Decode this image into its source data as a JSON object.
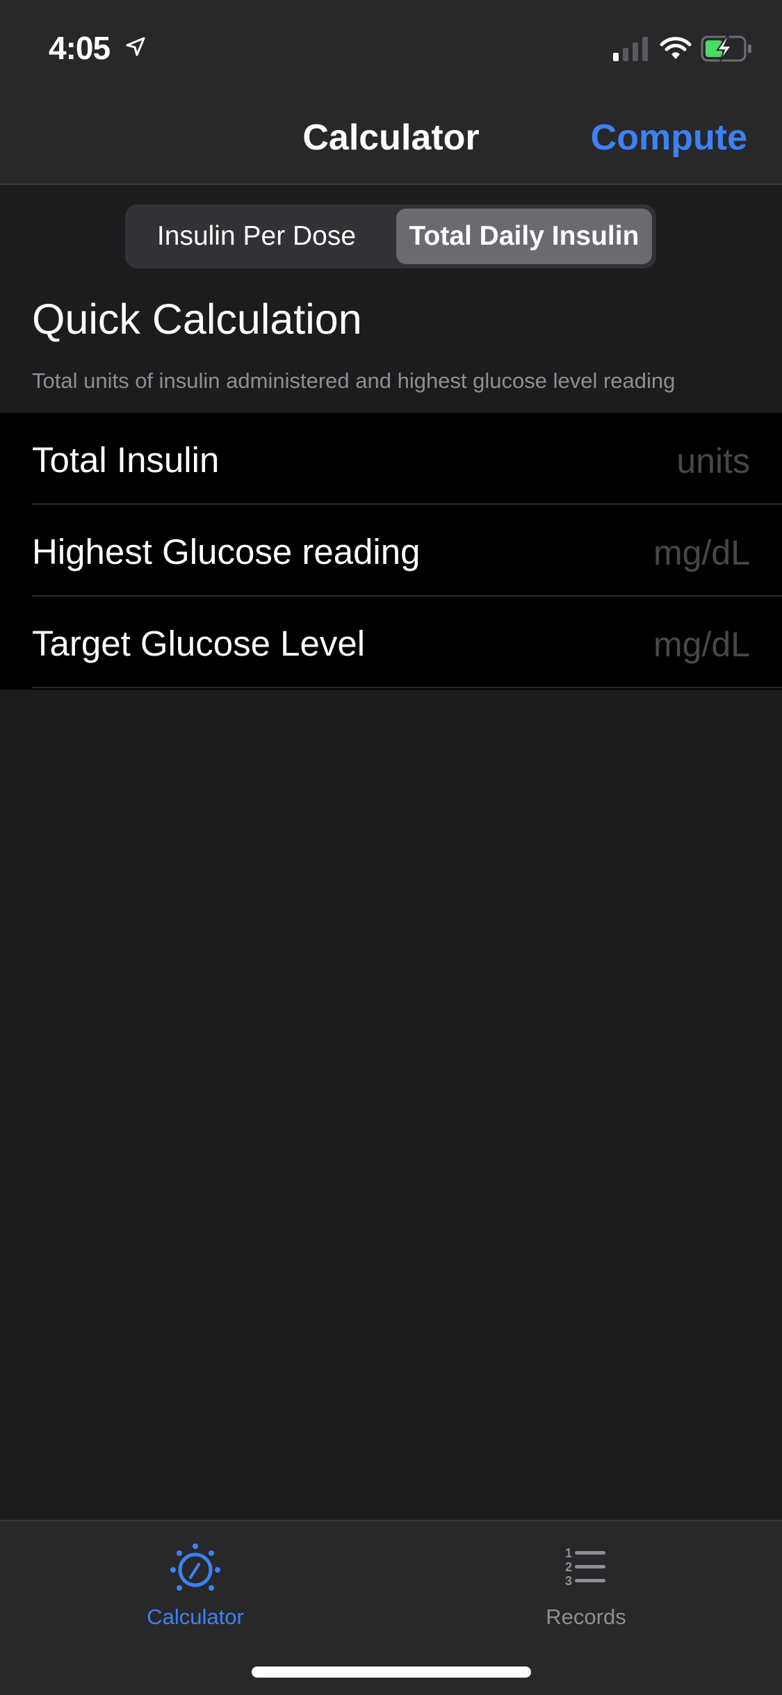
{
  "status_bar": {
    "time": "4:05",
    "icons": [
      "location-arrow-icon",
      "cellular-signal-icon",
      "wifi-icon",
      "battery-charging-icon"
    ],
    "battery_color": "#4cd964"
  },
  "nav": {
    "title": "Calculator",
    "action_label": "Compute",
    "accent_color": "#3b82f6"
  },
  "segmented": {
    "options": [
      "Insulin Per Dose",
      "Total Daily Insulin"
    ],
    "selected": "Total Daily Insulin"
  },
  "section": {
    "title": "Quick Calculation",
    "description": "Total units of insulin administered and highest glucose level reading"
  },
  "fields": [
    {
      "label": "Total Insulin",
      "placeholder": "units"
    },
    {
      "label": "Highest Glucose reading",
      "placeholder": "mg/dL"
    },
    {
      "label": "Target Glucose Level",
      "placeholder": "mg/dL"
    }
  ],
  "tabbar": {
    "items": [
      {
        "label": "Calculator",
        "icon": "dial-icon",
        "active": true
      },
      {
        "label": "Records",
        "icon": "numbered-list-icon",
        "active": false
      }
    ]
  }
}
